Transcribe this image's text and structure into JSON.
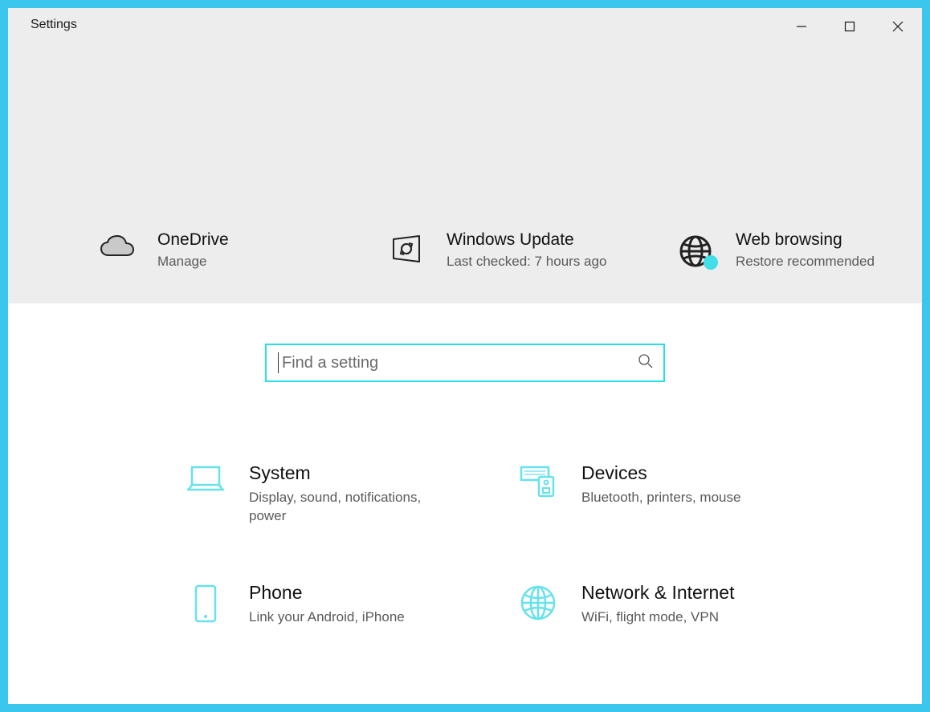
{
  "window": {
    "title": "Settings"
  },
  "colors": {
    "accent": "#26e0e6",
    "frame": "#3bc6ed",
    "header_bg": "#ededed",
    "icon_tint": "#66e2ea"
  },
  "status_tiles": [
    {
      "icon": "cloud-icon",
      "title": "OneDrive",
      "subtitle": "Manage"
    },
    {
      "icon": "update-icon",
      "title": "Windows Update",
      "subtitle": "Last checked: 7 hours ago"
    },
    {
      "icon": "globe-icon",
      "title": "Web browsing",
      "subtitle": "Restore recommended",
      "badge": true
    }
  ],
  "search": {
    "placeholder": "Find a setting",
    "value": ""
  },
  "categories": [
    {
      "icon": "laptop-icon",
      "title": "System",
      "subtitle": "Display, sound, notifications, power"
    },
    {
      "icon": "devices-icon",
      "title": "Devices",
      "subtitle": "Bluetooth, printers, mouse"
    },
    {
      "icon": "phone-icon",
      "title": "Phone",
      "subtitle": "Link your Android, iPhone"
    },
    {
      "icon": "network-icon",
      "title": "Network & Internet",
      "subtitle": "WiFi, flight mode, VPN"
    }
  ]
}
